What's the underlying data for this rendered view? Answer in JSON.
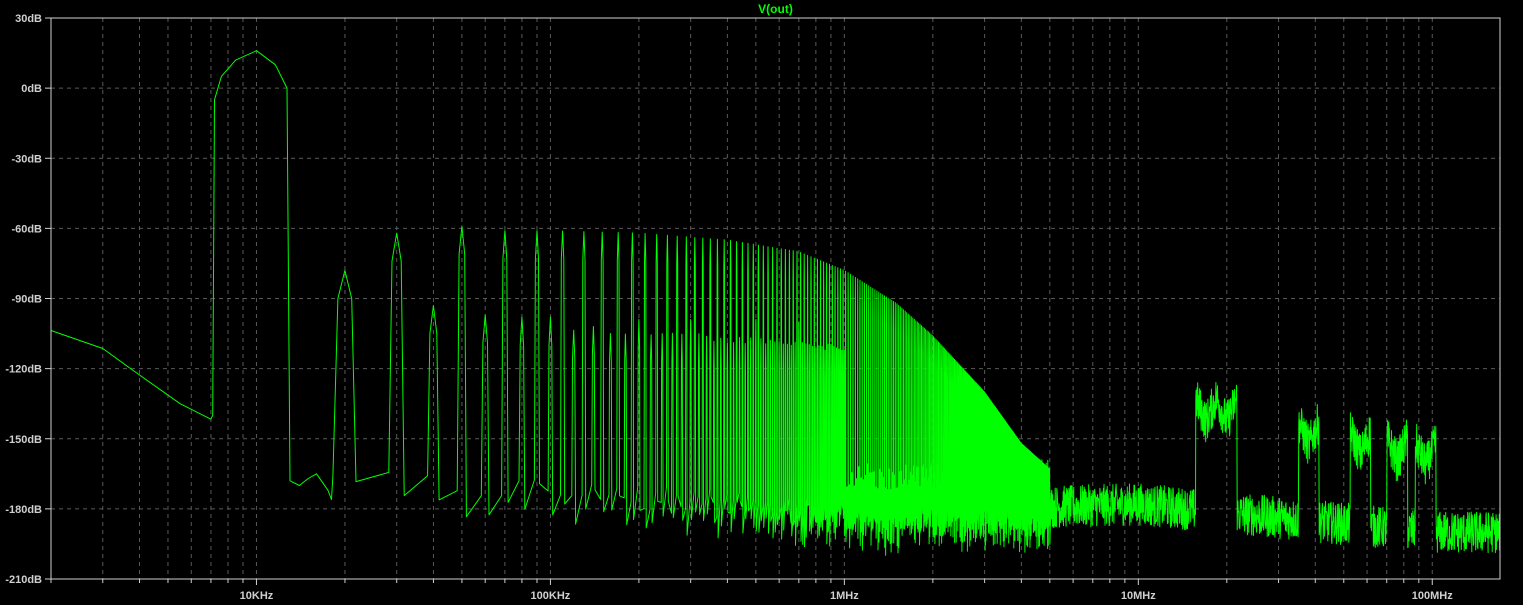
{
  "chart_data": {
    "type": "line",
    "title": "V(out)",
    "xscale": "log",
    "xlim_hz": [
      2000,
      170000000
    ],
    "ylim_db": [
      -210,
      30
    ],
    "grid": true,
    "x_ticks": [
      {
        "value": 10000,
        "label": "10KHz"
      },
      {
        "value": 100000,
        "label": "100KHz"
      },
      {
        "value": 1000000,
        "label": "1MHz"
      },
      {
        "value": 10000000,
        "label": "10MHz"
      },
      {
        "value": 100000000,
        "label": "100MHz"
      }
    ],
    "y_ticks": [
      {
        "value": 30,
        "label": "30dB"
      },
      {
        "value": 0,
        "label": "0dB"
      },
      {
        "value": -30,
        "label": "-30dB"
      },
      {
        "value": -60,
        "label": "-60dB"
      },
      {
        "value": -90,
        "label": "-90dB"
      },
      {
        "value": -120,
        "label": "-120dB"
      },
      {
        "value": -150,
        "label": "-150dB"
      },
      {
        "value": -180,
        "label": "-180dB"
      },
      {
        "value": -210,
        "label": "-210dB"
      }
    ],
    "series": [
      {
        "name": "V(out)",
        "color": "#00ff00",
        "fundamental_hz": 10000,
        "harmonic_peaks_db": [
          {
            "freq_hz": 10000,
            "db": 16
          },
          {
            "freq_hz": 20000,
            "db": -78
          },
          {
            "freq_hz": 30000,
            "db": -62
          },
          {
            "freq_hz": 40000,
            "db": -93
          },
          {
            "freq_hz": 50000,
            "db": -59
          },
          {
            "freq_hz": 60000,
            "db": -97
          },
          {
            "freq_hz": 70000,
            "db": -61
          },
          {
            "freq_hz": 80000,
            "db": -98
          },
          {
            "freq_hz": 90000,
            "db": -61
          },
          {
            "freq_hz": 100000,
            "db": -98
          },
          {
            "freq_hz": 200000,
            "db": -99
          },
          {
            "freq_hz": 300000,
            "db": -99
          },
          {
            "freq_hz": 500000,
            "db": -99
          },
          {
            "freq_hz": 700000,
            "db": -100
          }
        ],
        "odd_harmonic_envelope_db": [
          {
            "freq_hz": 50000,
            "db": -59
          },
          {
            "freq_hz": 100000,
            "db": -61
          },
          {
            "freq_hz": 200000,
            "db": -62
          },
          {
            "freq_hz": 400000,
            "db": -65
          },
          {
            "freq_hz": 700000,
            "db": -70
          },
          {
            "freq_hz": 1000000,
            "db": -78
          },
          {
            "freq_hz": 1500000,
            "db": -92
          },
          {
            "freq_hz": 2000000,
            "db": -106
          },
          {
            "freq_hz": 3000000,
            "db": -130
          },
          {
            "freq_hz": 4000000,
            "db": -152
          },
          {
            "freq_hz": 5000000,
            "db": -163
          }
        ],
        "low_freq_points_db": [
          {
            "freq_hz": 2000,
            "db": -104
          },
          {
            "freq_hz": 3000,
            "db": -111
          },
          {
            "freq_hz": 4000,
            "db": -123
          },
          {
            "freq_hz": 5500,
            "db": -136
          },
          {
            "freq_hz": 7000,
            "db": -142
          }
        ],
        "noise_floor_db": [
          {
            "freq_hz": 20000,
            "db": -168
          },
          {
            "freq_hz": 100000,
            "db": -172
          },
          {
            "freq_hz": 1000000,
            "db": -182
          },
          {
            "freq_hz": 10000000,
            "db": -178
          },
          {
            "freq_hz": 100000000,
            "db": -190
          }
        ],
        "spur_peaks_db": [
          {
            "freq_hz": 17000000,
            "db": -143
          },
          {
            "freq_hz": 20000000,
            "db": -143
          },
          {
            "freq_hz": 38000000,
            "db": -153
          },
          {
            "freq_hz": 57000000,
            "db": -157
          },
          {
            "freq_hz": 76000000,
            "db": -160
          },
          {
            "freq_hz": 95000000,
            "db": -162
          }
        ]
      }
    ]
  }
}
